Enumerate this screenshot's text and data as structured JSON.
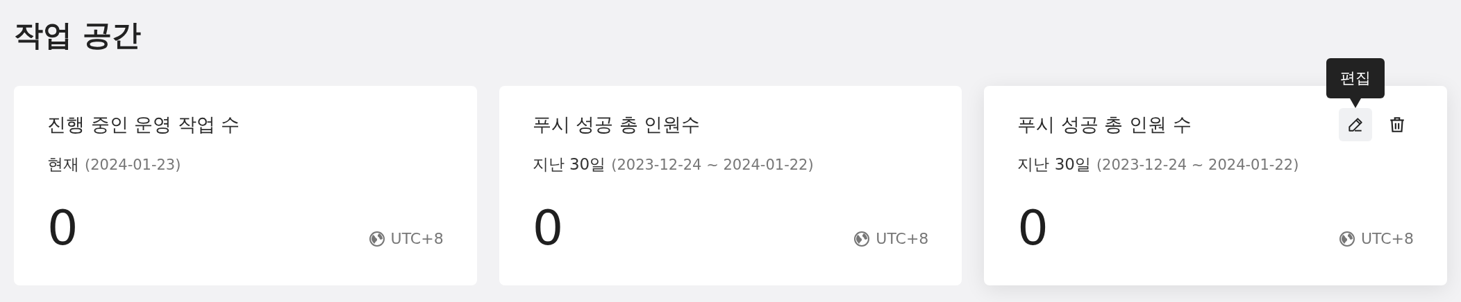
{
  "page": {
    "title": "작업 공간"
  },
  "cards": [
    {
      "title": "진행 중인 운영 작업 수",
      "period": "현재",
      "date_range": "(2024-01-23)",
      "value": "0",
      "timezone": "UTC+8",
      "hovered": false
    },
    {
      "title": "푸시 성공 총 인원수",
      "period": "지난 30일",
      "date_range": "(2023-12-24 ~ 2024-01-22)",
      "value": "0",
      "timezone": "UTC+8",
      "hovered": false
    },
    {
      "title": "푸시 성공 총 인원 수",
      "period": "지난 30일",
      "date_range": "(2023-12-24 ~ 2024-01-22)",
      "value": "0",
      "timezone": "UTC+8",
      "hovered": true,
      "actions": [
        {
          "kind": "edit",
          "hovered": true,
          "tooltip": "편집"
        },
        {
          "kind": "delete",
          "hovered": false
        }
      ]
    }
  ]
}
